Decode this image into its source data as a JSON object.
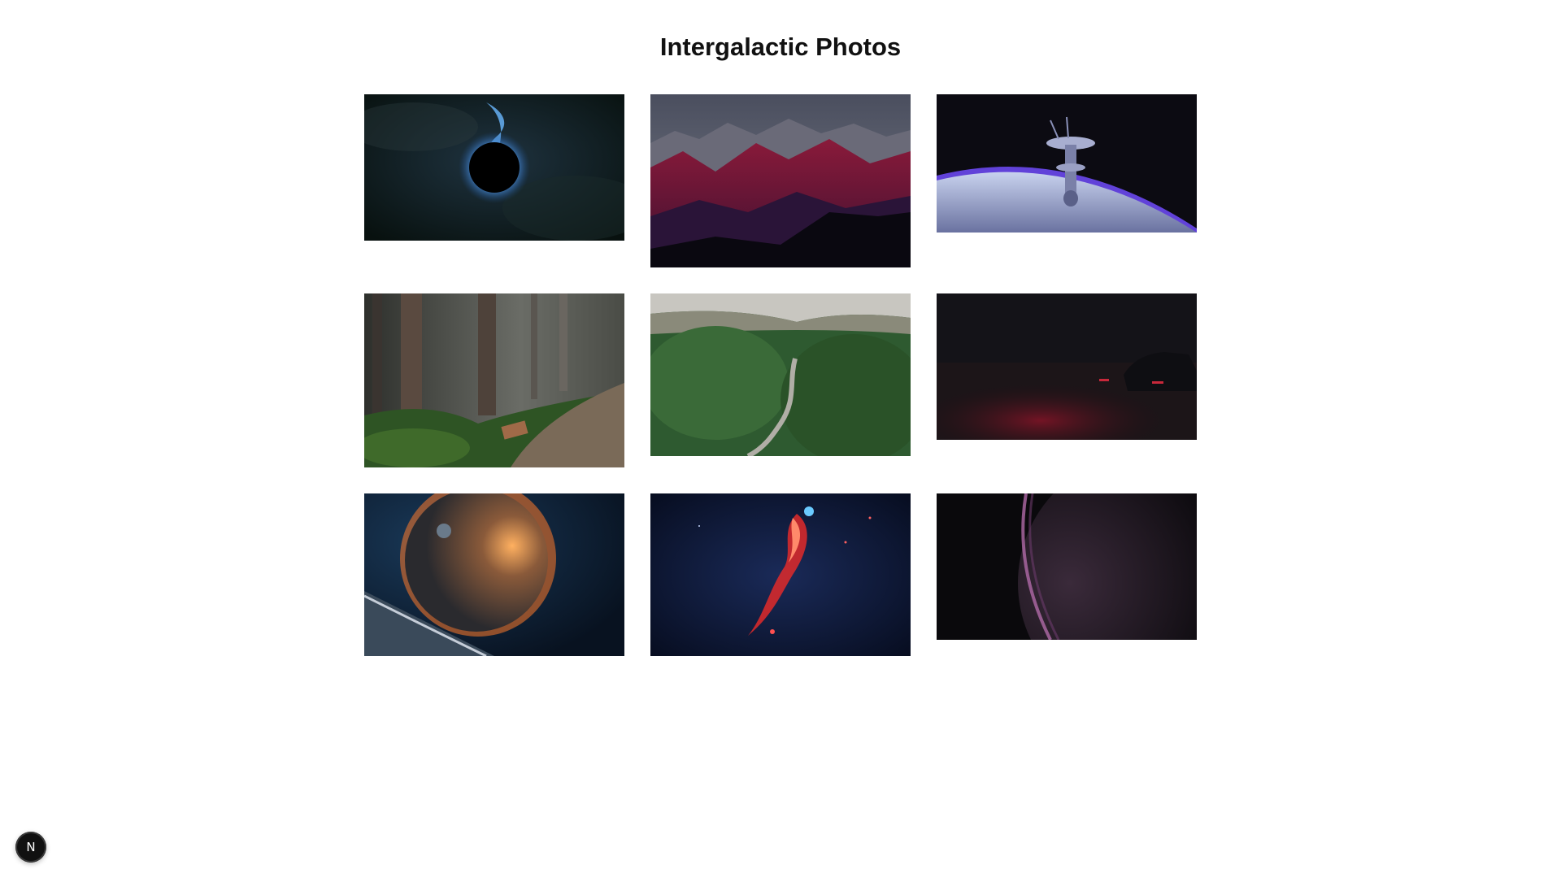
{
  "page": {
    "title": "Intergalactic Photos"
  },
  "gallery": {
    "photos": [
      {
        "id": 1,
        "subject": "black-hole",
        "colors": [
          "#0e1a22",
          "#3a78c8"
        ]
      },
      {
        "id": 2,
        "subject": "red-mountains",
        "colors": [
          "#5a6474",
          "#a0203a"
        ]
      },
      {
        "id": 3,
        "subject": "space-station",
        "colors": [
          "#0c0b12",
          "#5a40d8"
        ]
      },
      {
        "id": 4,
        "subject": "forest-path",
        "colors": [
          "#3b3d38",
          "#3f6a2a"
        ]
      },
      {
        "id": 5,
        "subject": "forest-road",
        "colors": [
          "#2e5a30",
          "#c8c6c0"
        ]
      },
      {
        "id": 6,
        "subject": "dark-car-night",
        "colors": [
          "#121116",
          "#8a1428"
        ]
      },
      {
        "id": 7,
        "subject": "planet-sunrise",
        "colors": [
          "#0e2238",
          "#ff7a2a"
        ]
      },
      {
        "id": 8,
        "subject": "red-nebula",
        "colors": [
          "#0c1838",
          "#e02a2a"
        ]
      },
      {
        "id": 9,
        "subject": "purple-planet",
        "colors": [
          "#0a090c",
          "#b06aa8"
        ]
      }
    ]
  },
  "dev_badge": {
    "label": "N"
  }
}
